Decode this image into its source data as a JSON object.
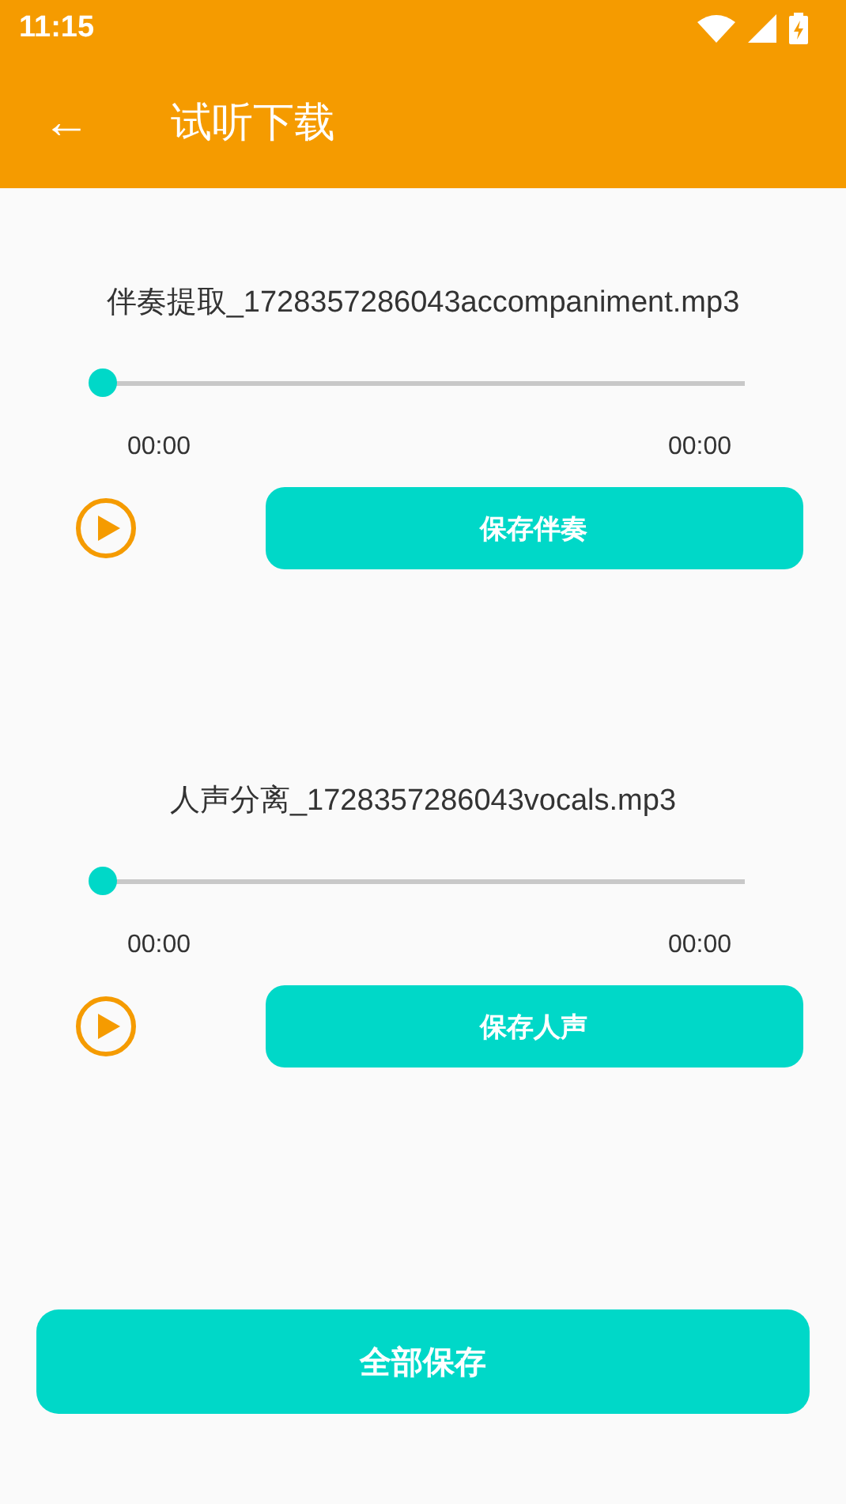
{
  "status_bar": {
    "time": "11:15"
  },
  "app_bar": {
    "back": "←",
    "title": "试听下载"
  },
  "tracks": [
    {
      "file_name": "伴奏提取_1728357286043accompaniment.mp3",
      "level": 0,
      "elapsed": "00:00",
      "duration": "00:00",
      "playing": false,
      "save_label": "保存伴奏"
    },
    {
      "file_name": "人声分离_1728357286043vocals.mp3",
      "level": 0,
      "elapsed": "00:00",
      "duration": "00:00",
      "playing": false,
      "save_label": "保存人声"
    }
  ],
  "save_all": "全部保存"
}
